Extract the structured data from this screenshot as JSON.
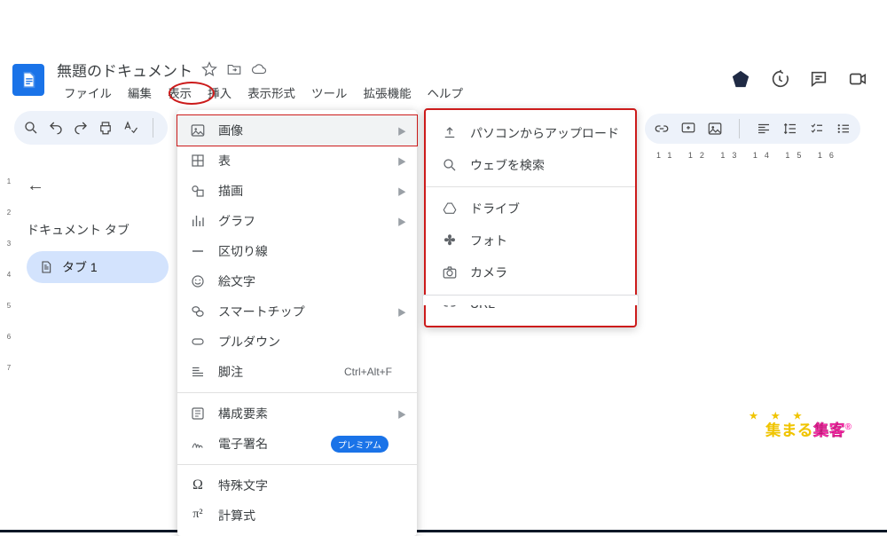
{
  "header": {
    "doc_title": "無題のドキュメント",
    "menus": [
      "ファイル",
      "編集",
      "表示",
      "挿入",
      "表示形式",
      "ツール",
      "拡張機能",
      "ヘルプ"
    ]
  },
  "sidebar": {
    "title": "ドキュメント タブ",
    "tab_label": "タブ 1"
  },
  "insert_menu": {
    "items": [
      {
        "label": "画像",
        "arrow": true,
        "highlight": true,
        "icon": "image"
      },
      {
        "label": "表",
        "arrow": true,
        "icon": "table"
      },
      {
        "label": "描画",
        "arrow": true,
        "icon": "drawing"
      },
      {
        "label": "グラフ",
        "arrow": true,
        "icon": "chart"
      },
      {
        "label": "区切り線",
        "icon": "hr"
      },
      {
        "label": "絵文字",
        "icon": "emoji"
      },
      {
        "label": "スマートチップ",
        "arrow": true,
        "icon": "chip"
      },
      {
        "label": "プルダウン",
        "icon": "dropdown"
      },
      {
        "label": "脚注",
        "shortcut": "Ctrl+Alt+F",
        "icon": "footnote"
      }
    ],
    "group2": [
      {
        "label": "構成要素",
        "arrow": true,
        "icon": "blocks"
      },
      {
        "label": "電子署名",
        "badge": "プレミアム",
        "icon": "sign"
      }
    ],
    "group3": [
      {
        "label": "特殊文字",
        "icon": "omega"
      },
      {
        "label": "計算式",
        "icon": "pi"
      }
    ]
  },
  "image_submenu": {
    "items1": [
      {
        "label": "パソコンからアップロード",
        "icon": "upload"
      },
      {
        "label": "ウェブを検索",
        "icon": "search"
      }
    ],
    "items2": [
      {
        "label": "ドライブ",
        "icon": "drive"
      },
      {
        "label": "フォト",
        "icon": "photos"
      },
      {
        "label": "カメラ",
        "icon": "camera"
      },
      {
        "label": "URL",
        "icon": "link"
      }
    ]
  },
  "ruler_h_ticks": "11 12 13 14 15 16",
  "ruler_v_ticks": [
    "1",
    "",
    "2",
    "",
    "3",
    "",
    "4",
    "",
    "5",
    "",
    "6",
    "",
    "7"
  ],
  "watermark": {
    "a": "集まる",
    "b": "集客",
    "r": "®"
  }
}
